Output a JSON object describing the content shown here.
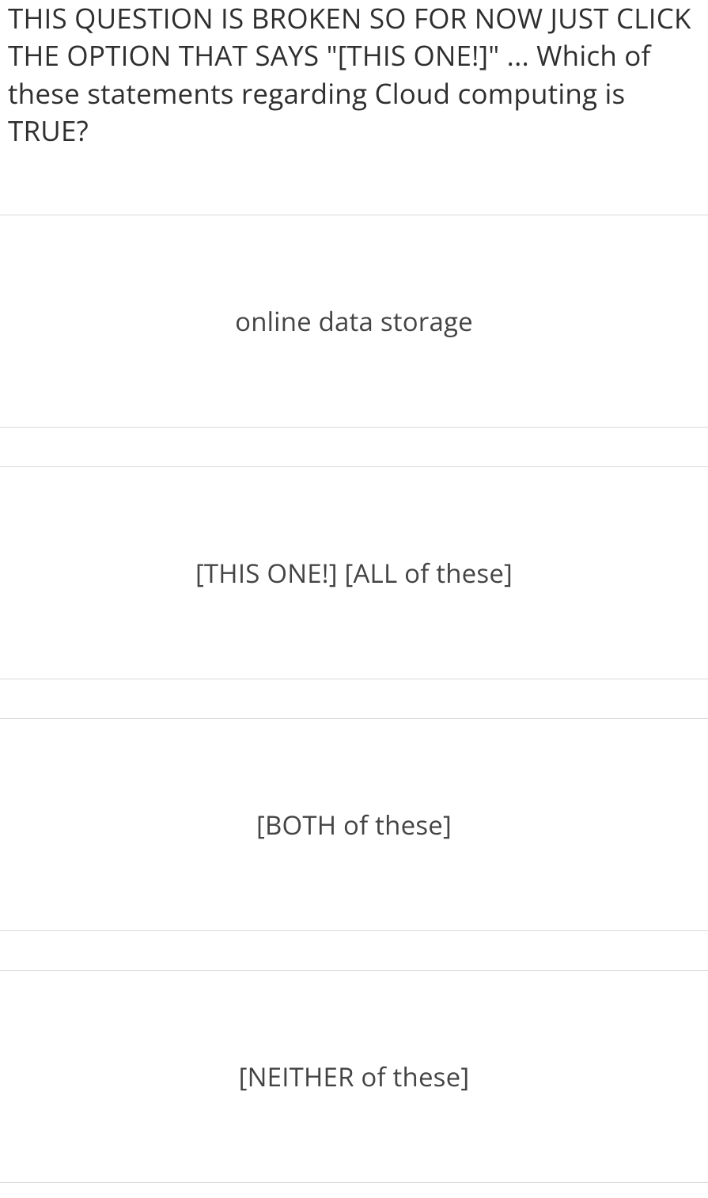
{
  "question": "THIS QUESTION IS BROKEN SO FOR NOW JUST CLICK THE OPTION THAT SAYS \"[THIS ONE!]\" ... Which of these statements regarding Cloud computing is TRUE?",
  "options": [
    {
      "label": "online data storage"
    },
    {
      "label": "[THIS ONE!] [ALL of these]"
    },
    {
      "label": "[BOTH of these]"
    },
    {
      "label": "[NEITHER of these]"
    }
  ]
}
